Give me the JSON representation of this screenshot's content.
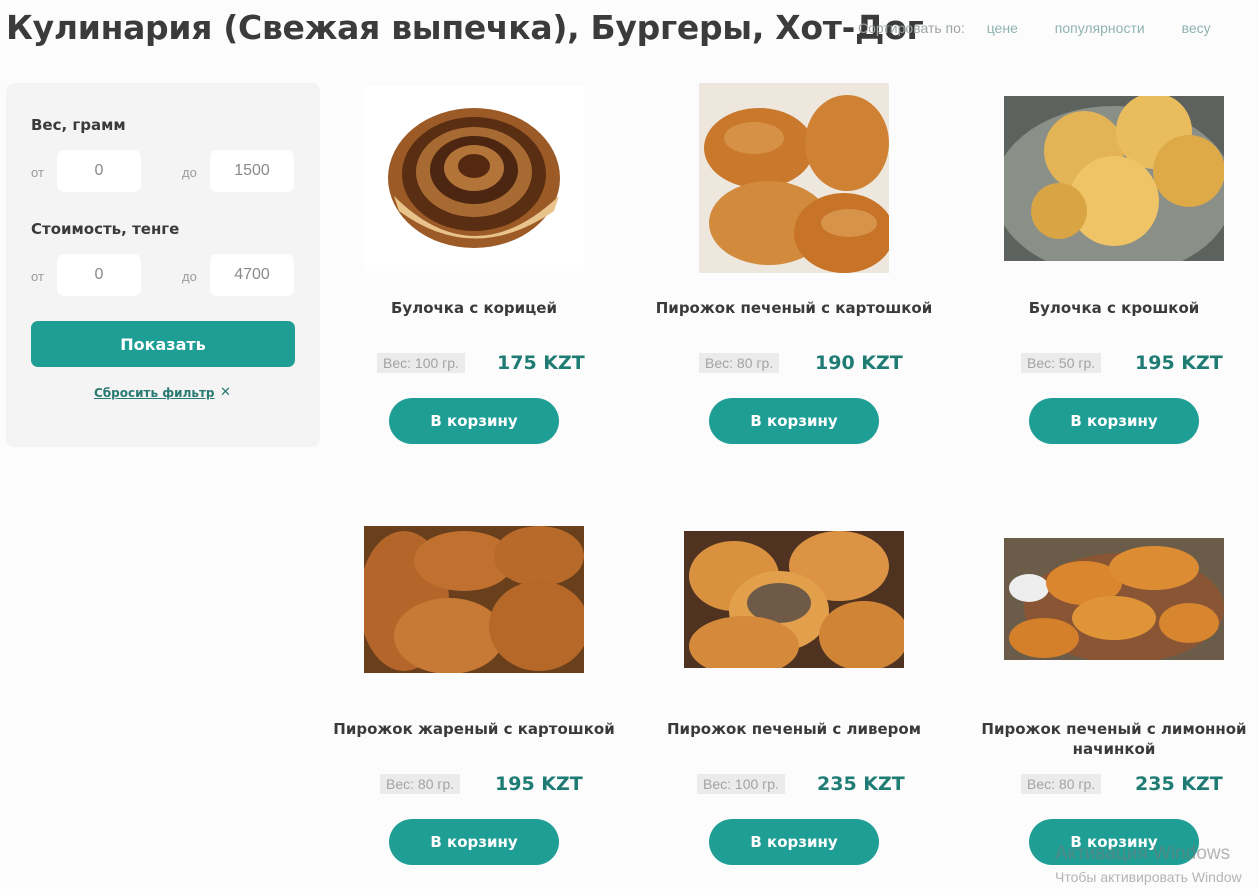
{
  "page": {
    "title": "Кулинария (Свежая выпечка), Бургеры, Хот-Дог"
  },
  "sort": {
    "label": "Сортировать по:",
    "options": [
      "цене",
      "популярности",
      "весу"
    ]
  },
  "filter": {
    "weight_heading": "Вес, грамм",
    "cost_heading": "Стоимость, тенге",
    "from_label": "от",
    "to_label": "до",
    "weight_from": "0",
    "weight_to": "1500",
    "cost_from": "0",
    "cost_to": "4700",
    "show_button": "Показать",
    "reset_link": "Сбросить фильтр",
    "reset_icon": "✕"
  },
  "products": [
    {
      "name": "Булочка с корицей",
      "weight": "Вес: 100 гр.",
      "price": "175 KZT",
      "cart": "В корзину",
      "image": "cinnamon-roll"
    },
    {
      "name": "Пирожок печеный с картошкой",
      "weight": "Вес: 80 гр.",
      "price": "190 KZT",
      "cart": "В корзину",
      "image": "baked-pies"
    },
    {
      "name": "Булочка с крошкой",
      "weight": "Вес: 50 гр.",
      "price": "195 KZT",
      "cart": "В корзину",
      "image": "crumb-buns"
    },
    {
      "name": "Пирожок жареный с картошкой",
      "weight": "Вес: 80 гр.",
      "price": "195 KZT",
      "cart": "В корзину",
      "image": "fried-pies"
    },
    {
      "name": "Пирожок печеный с ливером",
      "weight": "Вес: 100 гр.",
      "price": "235 KZT",
      "cart": "В корзину",
      "image": "liver-pies"
    },
    {
      "name": "Пирожок печеный с лимонной начинкой",
      "weight": "Вес: 80 гр.",
      "price": "235 KZT",
      "cart": "В корзину",
      "image": "lemon-pies"
    }
  ],
  "watermark": {
    "line1": "Активация Windows",
    "line2": "Чтобы активировать Window"
  }
}
